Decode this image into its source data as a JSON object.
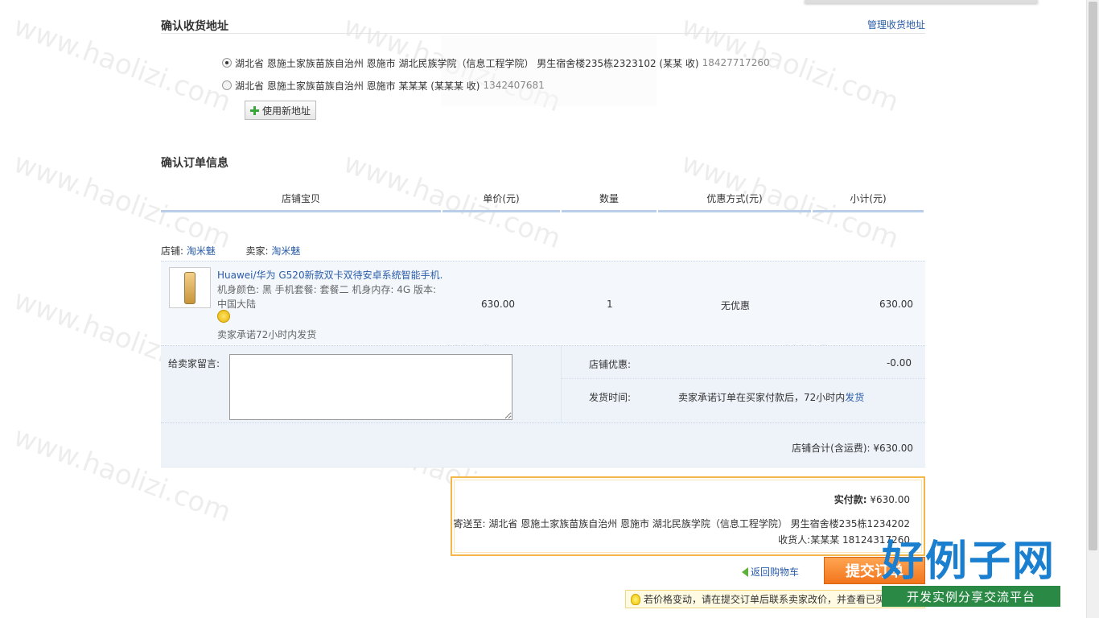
{
  "address_section": {
    "title": "确认收货地址",
    "manage_link": "管理收货地址",
    "addresses": [
      {
        "text": "湖北省 恩施土家族苗族自治州 恩施市 湖北民族学院（信息工程学院） 男生宿舍楼235栋2323102 (某某 收)",
        "phone": "18427717260",
        "selected": true
      },
      {
        "text": "湖北省 恩施土家族苗族自治州 恩施市 某某某 (某某某 收)",
        "phone": "1342407681",
        "selected": false
      }
    ],
    "new_address_button": "使用新地址"
  },
  "order_section": {
    "title": "确认订单信息",
    "columns": [
      "店铺宝贝",
      "单价(元)",
      "数量",
      "优惠方式(元)",
      "小计(元)"
    ],
    "shop_label": "店铺:",
    "shop_name": "淘米魅",
    "seller_label": "卖家:",
    "seller_name": "淘米魅",
    "item": {
      "name": "Huawei/华为 G520新款双卡双待安卓系统智能手机...",
      "sku": "机身颜色: 黑  手机套餐: 套餐二  机身内存: 4G  版本: 中国大陆",
      "promise": "卖家承诺72小时内发货",
      "price": "630.00",
      "qty": "1",
      "promo": "无优惠",
      "subtotal": "630.00"
    },
    "memo_label": "给卖家留言:",
    "shop_discount_label": "店铺优惠:",
    "shop_discount_value": "-0.00",
    "ship_time_label": "发货时间:",
    "ship_time_prefix": "卖家承诺订单在买家付款后，72小时内",
    "ship_time_link": "发货",
    "shop_total": "店铺合计(含运费): ¥630.00"
  },
  "payment": {
    "amount_label": "实付款:",
    "amount_value": "¥630.00",
    "ship_to": "寄送至: 湖北省 恩施土家族苗族自治州 恩施市 湖北民族学院（信息工程学院） 男生宿舍楼235栋1234202",
    "receiver": "收货人:某某某 18124317260"
  },
  "actions": {
    "back_cart": "返回购物车",
    "submit": "提交订单"
  },
  "tip": "若价格变动，请在提交订单后联系卖家改价，并查看已买到的宝贝",
  "watermark": {
    "text": "www.haolizi.com",
    "logo_main": "好例子网",
    "logo_sub": "开发实例分享交流平台"
  },
  "colors": {
    "link": "#2a5ca8",
    "submit": "#f2751c",
    "panel": "#eef3fa",
    "pay_border": "#f4b648"
  }
}
